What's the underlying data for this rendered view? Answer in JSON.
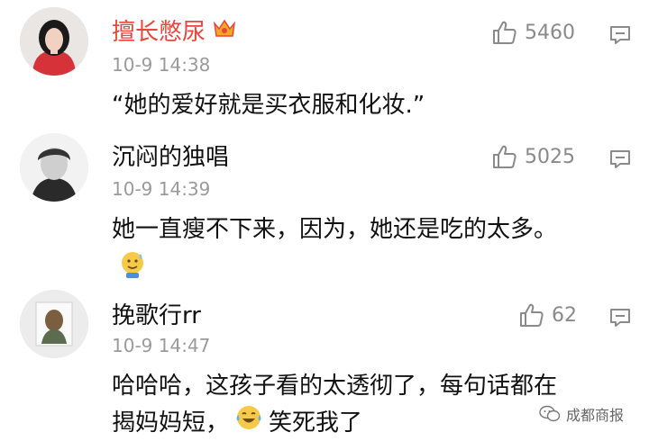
{
  "comments": [
    {
      "username": "擅长憋尿",
      "username_color": "#e8453c",
      "badge": "vip-crown-icon",
      "timestamp": "10-9 14:38",
      "likes": "5460",
      "content": "“她的爱好就是买衣服和化妆.”"
    },
    {
      "username": "沉闷的独唱",
      "username_color": "#111111",
      "timestamp": "10-9 14:39",
      "likes": "5025",
      "content": "她一直瘦不下来，因为，她还是吃的太多。",
      "emoji": "sweat-smile-emoji"
    },
    {
      "username": "挽歌行rr",
      "username_color": "#111111",
      "timestamp": "10-9 14:47",
      "likes": "62",
      "content_line1": "哈哈哈，这孩子看的太透彻了，每句话都在",
      "content_line2_a": "揭妈妈短，",
      "content_line2_b": "笑死我了",
      "emoji": "laughing-tears-emoji"
    }
  ],
  "watermark": {
    "text": "成都商报",
    "icon": "wechat-icon"
  }
}
